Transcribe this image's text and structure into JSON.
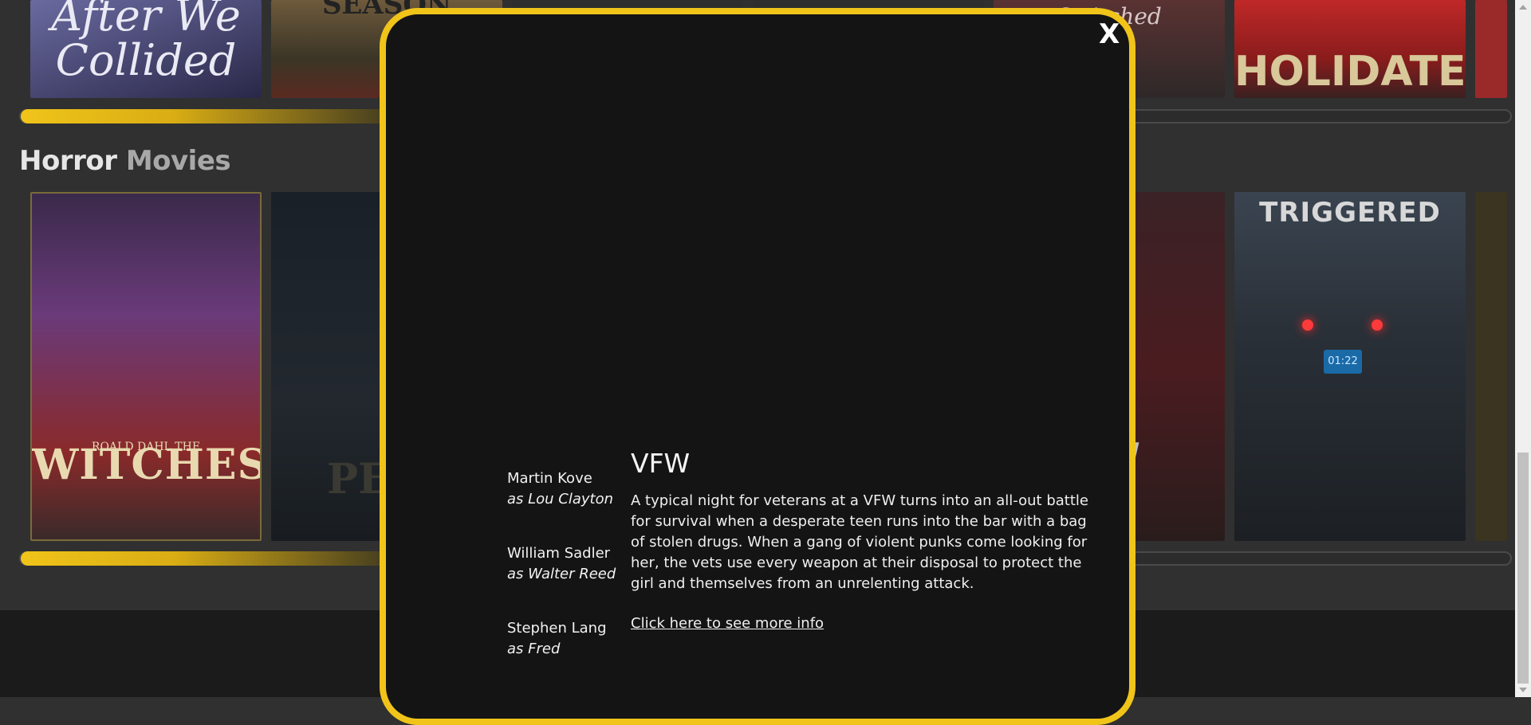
{
  "section": {
    "title_main": "Horror",
    "title_rest": " Movies"
  },
  "top_row": {
    "posters": [
      {
        "title": "After We Collided",
        "bg": "#3a3a6a"
      },
      {
        "title": "SEASON",
        "bg": "#4a3a2a"
      },
      {
        "title": "",
        "bg": "#2a2a2a"
      },
      {
        "title": "",
        "bg": "#2a2a2a"
      },
      {
        "title": "Switched",
        "bg": "#3a2a2a"
      },
      {
        "title": "HOLIDATE",
        "bg": "#b02020"
      }
    ]
  },
  "horror_row": {
    "posters": [
      {
        "title": "WITCHES",
        "subtitle": "ROALD DAHL THE",
        "bg": "#4a2a5a"
      },
      {
        "title": "PEN",
        "bg": "#1c2430"
      },
      {
        "title": "W",
        "bg": "#3a1c1c"
      },
      {
        "title": "TRIGGERED",
        "badge": "01:22",
        "bg": "#2a3038"
      }
    ]
  },
  "modal": {
    "close_label": "X",
    "movie_title": "VFW",
    "description": "A typical night for veterans at a VFW turns into an all-out battle for survival when a desperate teen runs into the bar with a bag of stolen drugs. When a gang of violent punks come looking for her, the vets use every weapon at their disposal to protect the girl and themselves from an unrelenting attack.",
    "more_info_link": "Click here to see more info",
    "cast": [
      {
        "name": "Martin Kove",
        "role": "as Lou Clayton"
      },
      {
        "name": "William Sadler",
        "role": "as Walter Reed"
      },
      {
        "name": "Stephen Lang",
        "role": "as Fred"
      }
    ]
  },
  "colors": {
    "accent": "#f0c419",
    "modal_bg": "#141414",
    "page_bg": "#303030"
  }
}
